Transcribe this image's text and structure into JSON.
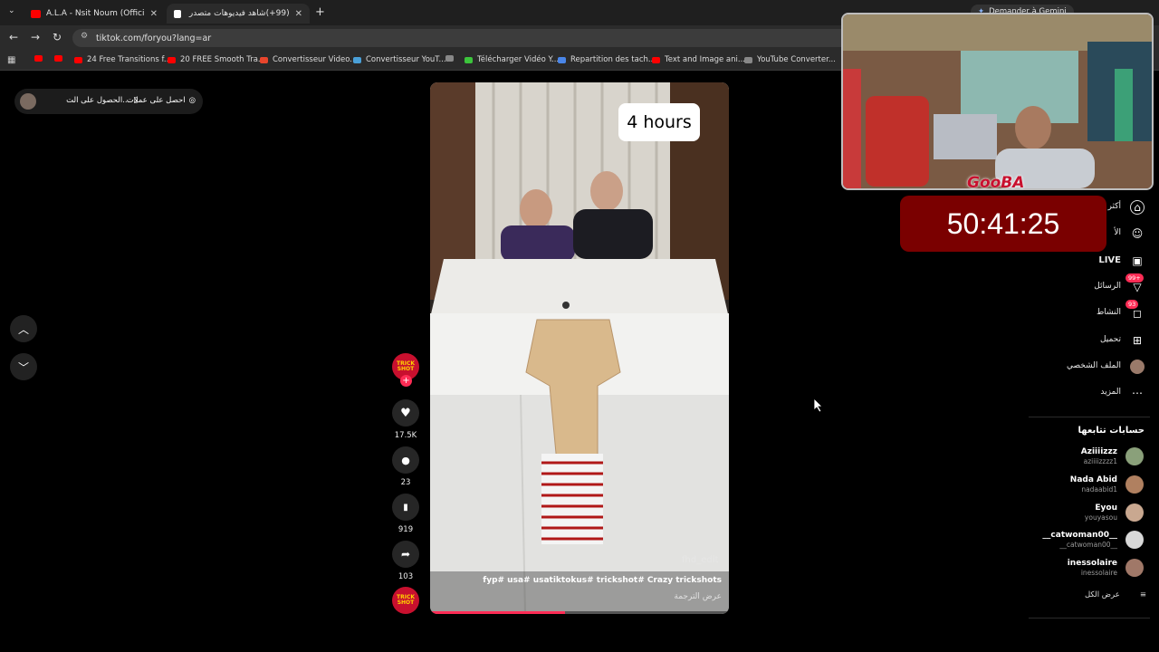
{
  "browser": {
    "tabs": [
      {
        "title": "A.L.A - Nsit Noum (Official Mus",
        "favicon_color": "#ff0000"
      },
      {
        "title": "(99+)شاهد فيديوهات متصدر",
        "favicon_color": "#ffffff"
      }
    ],
    "url": "tiktok.com/foryou?lang=ar",
    "gemini_button": "Demander à Gemini",
    "bookmarks": [
      {
        "label": "",
        "color": "#ff0000"
      },
      {
        "label": "",
        "color": "#ff0000"
      },
      {
        "label": "24 Free Transitions f...",
        "color": "#ff0000"
      },
      {
        "label": "20 FREE Smooth Tra...",
        "color": "#ff0000"
      },
      {
        "label": "Convertisseur Video...",
        "color": "#e8452c"
      },
      {
        "label": "Convertisseur YouT...",
        "color": "#4aa0d8"
      },
      {
        "label": "",
        "color": "#888888"
      },
      {
        "label": "Télécharger Vidéo Y...",
        "color": "#3cc43c"
      },
      {
        "label": "Repartition des tach...",
        "color": "#4a86e8"
      },
      {
        "label": "Text and Image ani...",
        "color": "#ff0000"
      },
      {
        "label": "YouTube Converter...",
        "color": "#888888"
      }
    ]
  },
  "promo": {
    "get_coins": "احصل على عملات",
    "get_app": "الحصول على الت..."
  },
  "video": {
    "overlay_text": "4 hours",
    "watermark": "fhd_edit",
    "caption": "fyp# usa# usatiktokus# trickshot# Crazy trickshots",
    "see_translation": "عرض الترجمة",
    "progress": 0.45
  },
  "actions": {
    "likes": "17.5K",
    "comments": "23",
    "saves": "919",
    "shares": "103",
    "avatar_text": "TRICK SHOT"
  },
  "sidebar": {
    "items": [
      {
        "label": "أكثر",
        "icon": "home-icon"
      },
      {
        "label": "الأ",
        "icon": "friends-icon"
      },
      {
        "label": "LIVE",
        "icon": "live-icon"
      },
      {
        "label": "الرسائل",
        "icon": "inbox-icon",
        "badge": "99+"
      },
      {
        "label": "النشاط",
        "icon": "activity-icon",
        "badge": "93"
      },
      {
        "label": "تحميل",
        "icon": "upload-icon"
      },
      {
        "label": "الملف الشخصي",
        "icon": "profile-icon"
      },
      {
        "label": "المزيد",
        "icon": "more-icon"
      }
    ],
    "following_title": "حسابات تتابعها",
    "accounts": [
      {
        "name": "Aziiiizzz",
        "handle": "aziiiizzzz1",
        "color": "#8aa07a"
      },
      {
        "name": "Nada Abid",
        "handle": "nadaabid1",
        "color": "#b08060"
      },
      {
        "name": "Eyou",
        "handle": "youyasou",
        "color": "#c9a890"
      },
      {
        "name": "__catwoman00__",
        "handle": "__catwoman00__",
        "color": "#d8d8d8"
      },
      {
        "name": "inessolaire",
        "handle": "inessolaire",
        "color": "#a07868"
      }
    ],
    "see_all": "عرض الكل"
  },
  "stream": {
    "streamer_tag": "GooBA",
    "timer": "50:41:25"
  }
}
